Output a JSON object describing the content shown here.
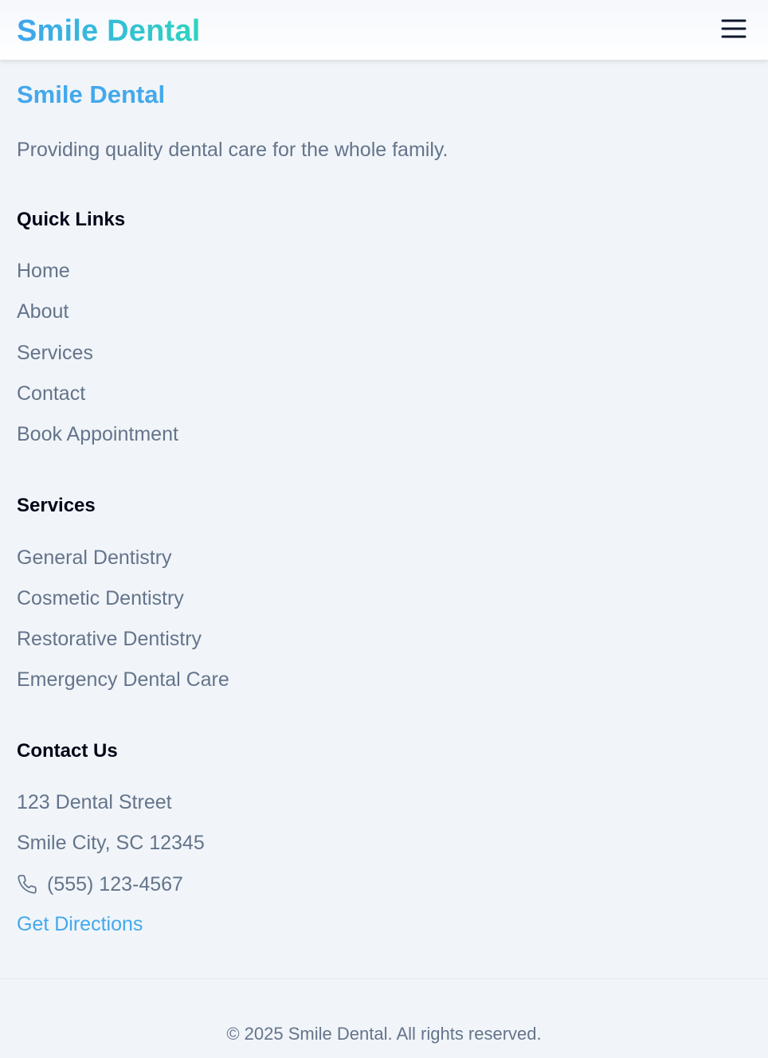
{
  "navbar": {
    "brand": "Smile Dental",
    "menu_icon": "hamburger-menu-icon"
  },
  "footer": {
    "brand": "Smile Dental",
    "tagline": "Providing quality dental care for the whole family.",
    "quick_links": {
      "title": "Quick Links",
      "items": [
        "Home",
        "About",
        "Services",
        "Contact",
        "Book Appointment"
      ]
    },
    "services": {
      "title": "Services",
      "items": [
        "General Dentistry",
        "Cosmetic Dentistry",
        "Restorative Dentistry",
        "Emergency Dental Care"
      ]
    },
    "contact": {
      "title": "Contact Us",
      "address_line1": "123 Dental Street",
      "address_line2": "Smile City, SC 12345",
      "phone_icon": "phone-icon",
      "phone": "(555) 123-4567",
      "directions_label": "Get Directions"
    },
    "copyright": "© 2025 Smile Dental. All rights reserved."
  },
  "colors": {
    "page_background": "#f1f5f9",
    "brand_gradient_start": "#3ea5ee",
    "brand_gradient_end": "#2dd4bf",
    "accent_blue": "#44a8ec",
    "heading_text": "#020617",
    "body_text": "#64748b"
  }
}
